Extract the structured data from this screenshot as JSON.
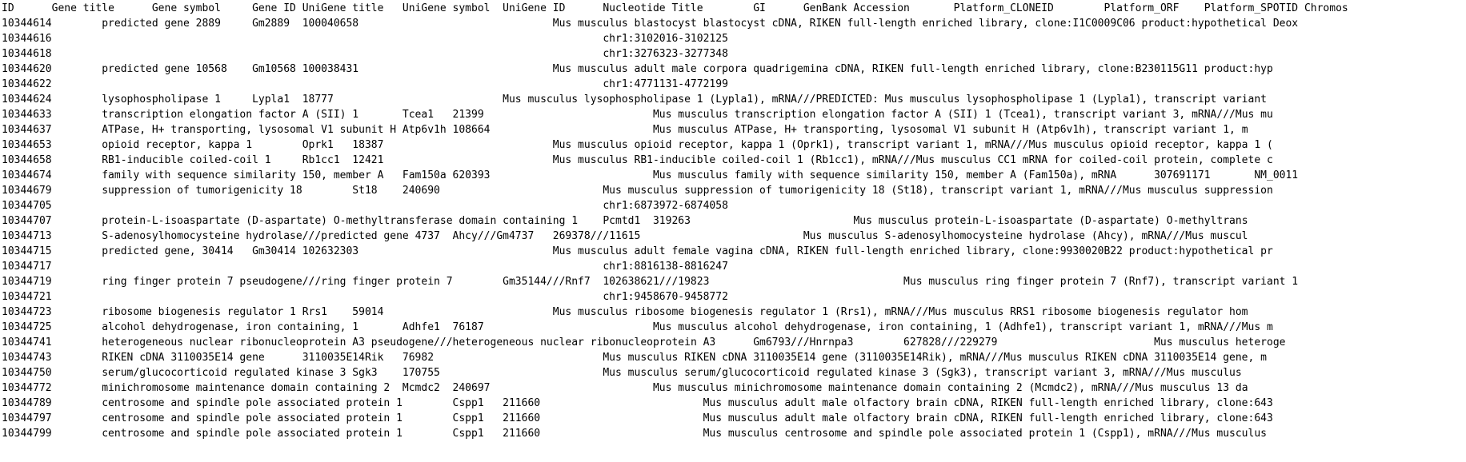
{
  "document": {
    "header": "ID\tGene title\tGene symbol\tGene ID\tUniGene title\tUniGene symbol\tUniGene ID\tNucleotide Title\tGI\tGenBank Accession\tPlatform_CLONEID\tPlatform_ORF\tPlatform_SPOTID\tChromos",
    "rows": [
      "10344614\tpredicted gene 2889\tGm2889\t100040658\t\t\t\tMus musculus blastocyst blastocyst cDNA, RIKEN full-length enriched library, clone:I1C0009C06 product:hypothetical Deox",
      "10344616\t\t\t\t\t\t\t\t\t\t\tchr1:3102016-3102125",
      "10344618\t\t\t\t\t\t\t\t\t\t\tchr1:3276323-3277348",
      "10344620\tpredicted gene 10568\tGm10568\t100038431\t\t\t\tMus musculus adult male corpora quadrigemina cDNA, RIKEN full-length enriched library, clone:B230115G11 product:hyp",
      "10344622\t\t\t\t\t\t\t\t\t\t\tchr1:4771131-4772199",
      "10344624\tlysophospholipase 1\tLypla1\t18777\t\t\t\tMus musculus lysophospholipase 1 (Lypla1), mRNA///PREDICTED: Mus musculus lysophospholipase 1 (Lypla1), transcript variant",
      "10344633\ttranscription elongation factor A (SII) 1\tTcea1\t21399\t\t\t\tMus musculus transcription elongation factor A (SII) 1 (Tcea1), transcript variant 3, mRNA///Mus mu",
      "10344637\tATPase, H+ transporting, lysosomal V1 subunit H\tAtp6v1h\t108664\t\t\t\tMus musculus ATPase, H+ transporting, lysosomal V1 subunit H (Atp6v1h), transcript variant 1, m",
      "10344653\topioid receptor, kappa 1\tOprk1\t18387\t\t\t\tMus musculus opioid receptor, kappa 1 (Oprk1), transcript variant 1, mRNA///Mus musculus opioid receptor, kappa 1 (",
      "10344658\tRB1-inducible coiled-coil 1\tRb1cc1\t12421\t\t\t\tMus musculus RB1-inducible coiled-coil 1 (Rb1cc1), mRNA///Mus musculus CC1 mRNA for coiled-coil protein, complete c",
      "10344674\tfamily with sequence similarity 150, member A\tFam150a\t620393\t\t\t\tMus musculus family with sequence similarity 150, member A (Fam150a), mRNA\t307691171\tNM_0011",
      "10344679\tsuppression of tumorigenicity 18\tSt18\t240690\t\t\t\tMus musculus suppression of tumorigenicity 18 (St18), transcript variant 1, mRNA///Mus musculus suppression",
      "10344705\t\t\t\t\t\t\t\t\t\t\tchr1:6873972-6874058",
      "10344707\tprotein-L-isoaspartate (D-aspartate) O-methyltransferase domain containing 1\tPcmtd1\t319263\t\t\t\tMus musculus protein-L-isoaspartate (D-aspartate) O-methyltrans",
      "10344713\tS-adenosylhomocysteine hydrolase///predicted gene 4737\tAhcy///Gm4737\t269378///11615\t\t\t\tMus musculus S-adenosylhomocysteine hydrolase (Ahcy), mRNA///Mus muscul",
      "10344715\tpredicted gene, 30414\tGm30414\t102632303\t\t\t\tMus musculus adult female vagina cDNA, RIKEN full-length enriched library, clone:9930020B22 product:hypothetical pr",
      "10344717\t\t\t\t\t\t\t\t\t\t\tchr1:8816138-8816247",
      "10344719\tring finger protein 7 pseudogene///ring finger protein 7\tGm35144///Rnf7\t102638621///19823\t\t\t\tMus musculus ring finger protein 7 (Rnf7), transcript variant 1",
      "10344721\t\t\t\t\t\t\t\t\t\t\tchr1:9458670-9458772",
      "10344723\tribosome biogenesis regulator 1\tRrs1\t59014\t\t\t\tMus musculus ribosome biogenesis regulator 1 (Rrs1), mRNA///Mus musculus RRS1 ribosome biogenesis regulator hom",
      "10344725\talcohol dehydrogenase, iron containing, 1\tAdhfe1\t76187\t\t\t\tMus musculus alcohol dehydrogenase, iron containing, 1 (Adhfe1), transcript variant 1, mRNA///Mus m",
      "10344741\theterogeneous nuclear ribonucleoprotein A3 pseudogene///heterogeneous nuclear ribonucleoprotein A3\tGm6793///Hnrnpa3\t627828///229279\t\t\t\tMus musculus heteroge",
      "10344743\tRIKEN cDNA 3110035E14 gene\t3110035E14Rik\t76982\t\t\t\tMus musculus RIKEN cDNA 3110035E14 gene (3110035E14Rik), mRNA///Mus musculus RIKEN cDNA 3110035E14 gene, m",
      "10344750\tserum/glucocorticoid regulated kinase 3\tSgk3\t170755\t\t\t\tMus musculus serum/glucocorticoid regulated kinase 3 (Sgk3), transcript variant 3, mRNA///Mus musculus",
      "10344772\tminichromosome maintenance domain containing 2\tMcmdc2\t240697\t\t\t\tMus musculus minichromosome maintenance domain containing 2 (Mcmdc2), mRNA///Mus musculus 13 da",
      "10344789\tcentrosome and spindle pole associated protein 1\tCspp1\t211660\t\t\t\tMus musculus adult male olfactory brain cDNA, RIKEN full-length enriched library, clone:643",
      "10344797\tcentrosome and spindle pole associated protein 1\tCspp1\t211660\t\t\t\tMus musculus adult male olfactory brain cDNA, RIKEN full-length enriched library, clone:643",
      "10344799\tcentrosome and spindle pole associated protein 1\tCspp1\t211660\t\t\t\tMus musculus centrosome and spindle pole associated protein 1 (Cspp1), mRNA///Mus musculus"
    ]
  }
}
